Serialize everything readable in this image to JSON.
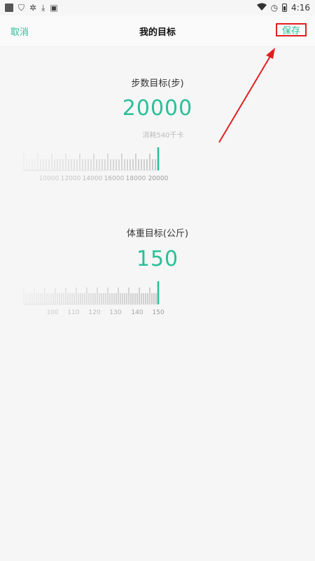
{
  "status_bar": {
    "time": "4:16",
    "left_icons": [
      "app-square-icon",
      "shield-icon",
      "bug-icon",
      "download-icon",
      "notification-icon"
    ],
    "right_icons": [
      "wifi-icon",
      "alarm-icon",
      "battery-icon"
    ]
  },
  "header": {
    "cancel_label": "取消",
    "title": "我的目标",
    "save_label": "保存"
  },
  "steps_goal": {
    "label": "步数目标(步)",
    "value": "20000",
    "calories_text": "消耗540千卡",
    "ruler_ticks": [
      "10000",
      "12000",
      "14000",
      "16000",
      "18000",
      "20000"
    ]
  },
  "weight_goal": {
    "label": "体重目标(公斤)",
    "value": "150",
    "ruler_ticks": [
      "100",
      "110",
      "120",
      "130",
      "140",
      "150"
    ]
  },
  "colors": {
    "accent": "#2bbf98",
    "annotation": "#e02020"
  }
}
